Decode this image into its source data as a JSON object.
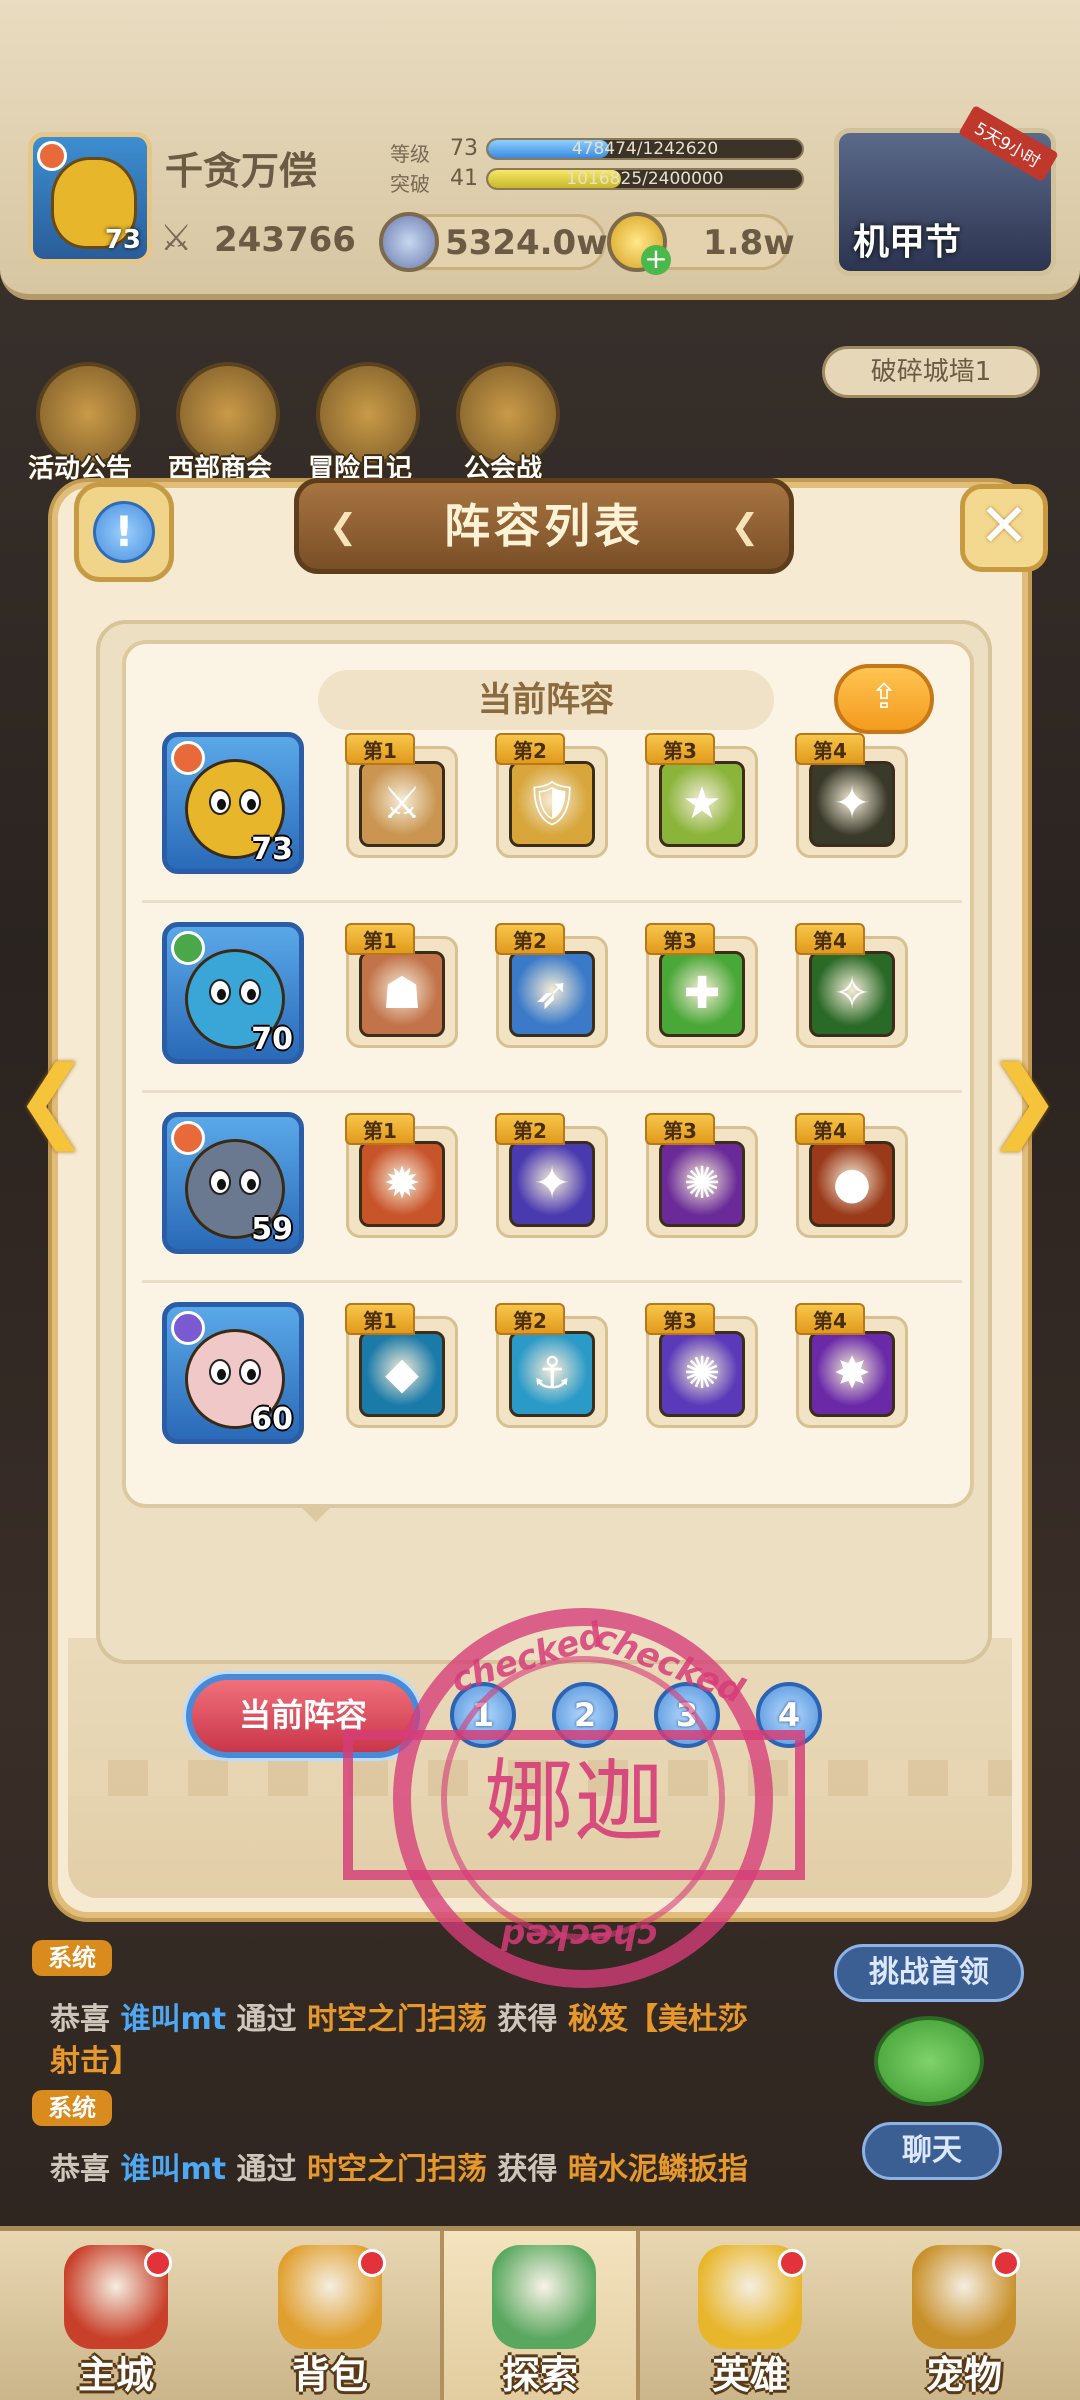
{
  "player": {
    "name": "千贪万偿",
    "level": "73",
    "level_label": "等级",
    "level_value": "73",
    "level_progress_text": "478474/1242620",
    "level_progress": 0.385,
    "breakthrough_label": "突破",
    "breakthrough_value": "41",
    "breakthrough_progress_text": "1016825/2400000",
    "breakthrough_progress": 0.424,
    "power": "243766"
  },
  "resources": {
    "silver": "5324.0w",
    "gold": "1.8w"
  },
  "event": {
    "title": "机甲节",
    "timer": "5天9小时"
  },
  "shortcuts": [
    {
      "label": "活动公告"
    },
    {
      "label": "西部商会"
    },
    {
      "label": "冒险日记"
    },
    {
      "label": "公会战"
    }
  ],
  "stage": {
    "label": "破碎城墙1"
  },
  "dialog": {
    "title": "阵容列表",
    "current_header": "当前阵容",
    "close_glyph": "✕",
    "info_glyph": "!",
    "share_glyph": "⇪"
  },
  "lineup": [
    {
      "level": "73",
      "color": "#e8b62b",
      "badge_color": "#e86a3a",
      "skills": [
        {
          "rank": "第1",
          "color": "#c99550",
          "glyph": "⚔"
        },
        {
          "rank": "第2",
          "color": "#d8a63a",
          "glyph": "🛡"
        },
        {
          "rank": "第3",
          "color": "#8ab43a",
          "glyph": "★"
        },
        {
          "rank": "第4",
          "color": "#3a3a2a",
          "glyph": "✦"
        }
      ]
    },
    {
      "level": "70",
      "color": "#3aa6d8",
      "badge_color": "#4aa84a",
      "skills": [
        {
          "rank": "第1",
          "color": "#c2734a",
          "glyph": "☗"
        },
        {
          "rank": "第2",
          "color": "#3a7ac8",
          "glyph": "➶"
        },
        {
          "rank": "第3",
          "color": "#4aa838",
          "glyph": "✚"
        },
        {
          "rank": "第4",
          "color": "#2a6a28",
          "glyph": "✧"
        }
      ]
    },
    {
      "level": "59",
      "color": "#6a7890",
      "badge_color": "#e86a3a",
      "skills": [
        {
          "rank": "第1",
          "color": "#c8542a",
          "glyph": "✹"
        },
        {
          "rank": "第2",
          "color": "#4a3ab0",
          "glyph": "✦"
        },
        {
          "rank": "第3",
          "color": "#6a2a98",
          "glyph": "✺"
        },
        {
          "rank": "第4",
          "color": "#9a3a1a",
          "glyph": "●"
        }
      ]
    },
    {
      "level": "60",
      "color": "#f0c8c8",
      "badge_color": "#7a5ad0",
      "skills": [
        {
          "rank": "第1",
          "color": "#1a7aa8",
          "glyph": "◆"
        },
        {
          "rank": "第2",
          "color": "#2a9ac8",
          "glyph": "⚓"
        },
        {
          "rank": "第3",
          "color": "#5a3ab8",
          "glyph": "✺"
        },
        {
          "rank": "第4",
          "color": "#6a2aa8",
          "glyph": "✸"
        }
      ]
    }
  ],
  "tabs": {
    "current": "当前阵容",
    "numbers": [
      "1",
      "2",
      "3",
      "4"
    ]
  },
  "stamp": {
    "word": "checked",
    "name": "娜迦"
  },
  "chat": [
    {
      "tag": "系统",
      "prefix": "恭喜",
      "user": "谁叫mt",
      "via": "通过",
      "place": "时空之门扫荡",
      "got": "获得",
      "item": "秘笈【美杜莎",
      "item2": "射击】"
    },
    {
      "tag": "系统",
      "prefix": "恭喜",
      "user": "谁叫mt",
      "via": "通过",
      "place": "时空之门扫荡",
      "got": "获得",
      "item": "暗水泥鳞扳指"
    }
  ],
  "side_buttons": {
    "challenge": "挑战首领",
    "chat": "聊天"
  },
  "nav": [
    {
      "label": "主城",
      "color": "#c8402a"
    },
    {
      "label": "背包",
      "color": "#e0a030"
    },
    {
      "label": "探索",
      "color": "#5aa860"
    },
    {
      "label": "英雄",
      "color": "#e8b62b"
    },
    {
      "label": "宠物",
      "color": "#c8902a"
    }
  ]
}
